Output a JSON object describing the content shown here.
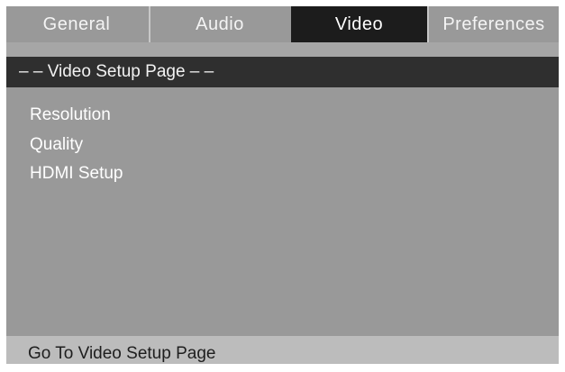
{
  "tabs": [
    {
      "label": "General"
    },
    {
      "label": "Audio"
    },
    {
      "label": "Video"
    },
    {
      "label": "Preferences"
    }
  ],
  "active_tab": "Video",
  "header": {
    "title": "– – Video Setup Page  – –"
  },
  "menu": {
    "items": [
      {
        "label": "Resolution"
      },
      {
        "label": "Quality"
      },
      {
        "label": "HDMI Setup"
      }
    ]
  },
  "status": {
    "text": "Go To Video Setup Page"
  },
  "colors": {
    "panel": "#999999",
    "active_tab": "#1c1c1c",
    "header_bar": "#2f2f2f",
    "status_bar": "#bcbcbc",
    "text_light": "#ffffff",
    "text_dark": "#1e1e1e"
  }
}
